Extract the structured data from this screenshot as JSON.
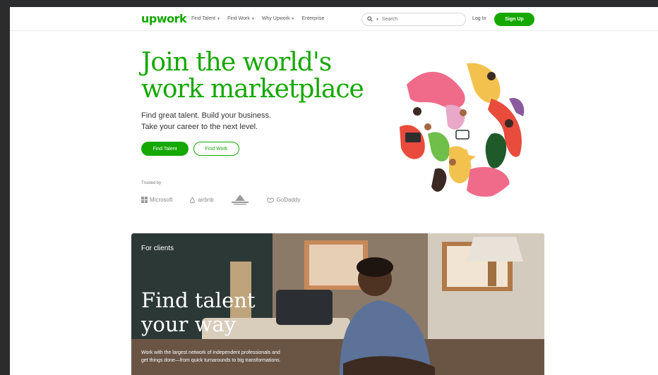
{
  "header": {
    "logo": "upwork",
    "nav": [
      {
        "label": "Find Talent"
      },
      {
        "label": "Find Work"
      },
      {
        "label": "Why Upwork"
      },
      {
        "label": "Enterprise"
      }
    ],
    "search_placeholder": "Search",
    "login_label": "Log In",
    "signup_label": "Sign Up"
  },
  "hero": {
    "title_line1": "Join the world's",
    "title_line2": "work marketplace",
    "subtitle_line1": "Find great talent. Build your business.",
    "subtitle_line2": "Take your career to the next level.",
    "find_talent_label": "Find Talent",
    "find_work_label": "Find Work",
    "trusted_label": "Trusted by",
    "trusted_logos": [
      "Microsoft",
      "airbnb",
      "",
      "GoDaddy"
    ]
  },
  "clients": {
    "label": "For clients",
    "title_line1": "Find talent",
    "title_line2": "your way",
    "description": "Work with the largest network of independent professionals and get things done—from quick turnarounds to big transformations."
  },
  "colors": {
    "brand_green": "#14a800",
    "window_background": "#2b2c2e"
  }
}
